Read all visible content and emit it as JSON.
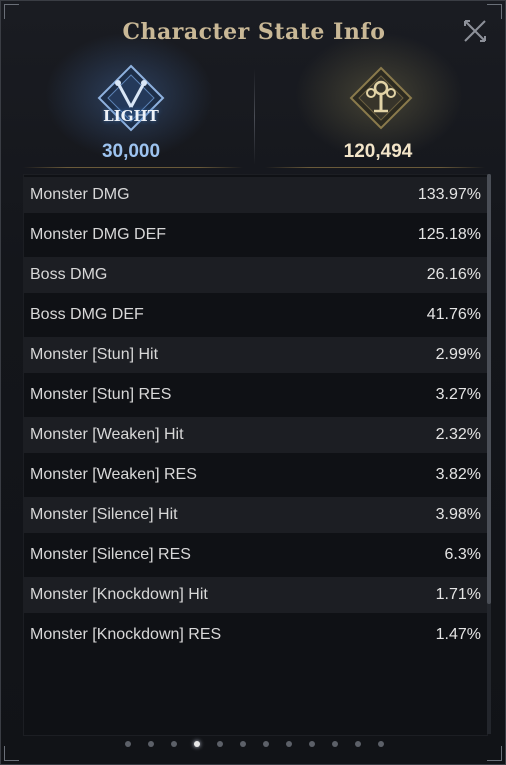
{
  "window": {
    "title": "Character State Info"
  },
  "icons": {
    "close": "close-icon",
    "light_emblem": "light-emblem-icon",
    "tree_emblem": "tree-emblem-icon"
  },
  "left_stat": {
    "label": "LIGHT",
    "value": "30,000",
    "color": "#9dc3ef"
  },
  "right_stat": {
    "value": "120,494",
    "color": "#f2e4c8"
  },
  "stats": [
    {
      "name": "Monster DMG",
      "value": "133.97%"
    },
    {
      "name": "Monster DMG DEF",
      "value": "125.18%"
    },
    {
      "name": "Boss DMG",
      "value": "26.16%"
    },
    {
      "name": "Boss DMG DEF",
      "value": "41.76%"
    },
    {
      "name": "Monster [Stun] Hit",
      "value": "2.99%"
    },
    {
      "name": "Monster [Stun] RES",
      "value": "3.27%"
    },
    {
      "name": "Monster [Weaken] Hit",
      "value": "2.32%"
    },
    {
      "name": "Monster [Weaken] RES",
      "value": "3.82%"
    },
    {
      "name": "Monster [Silence] Hit",
      "value": "3.98%"
    },
    {
      "name": "Monster [Silence] RES",
      "value": "6.3%"
    },
    {
      "name": "Monster [Knockdown] Hit",
      "value": "1.71%"
    },
    {
      "name": "Monster [Knockdown] RES",
      "value": "1.47%"
    }
  ],
  "pagination": {
    "total_pages": 12,
    "active_page": 4
  }
}
